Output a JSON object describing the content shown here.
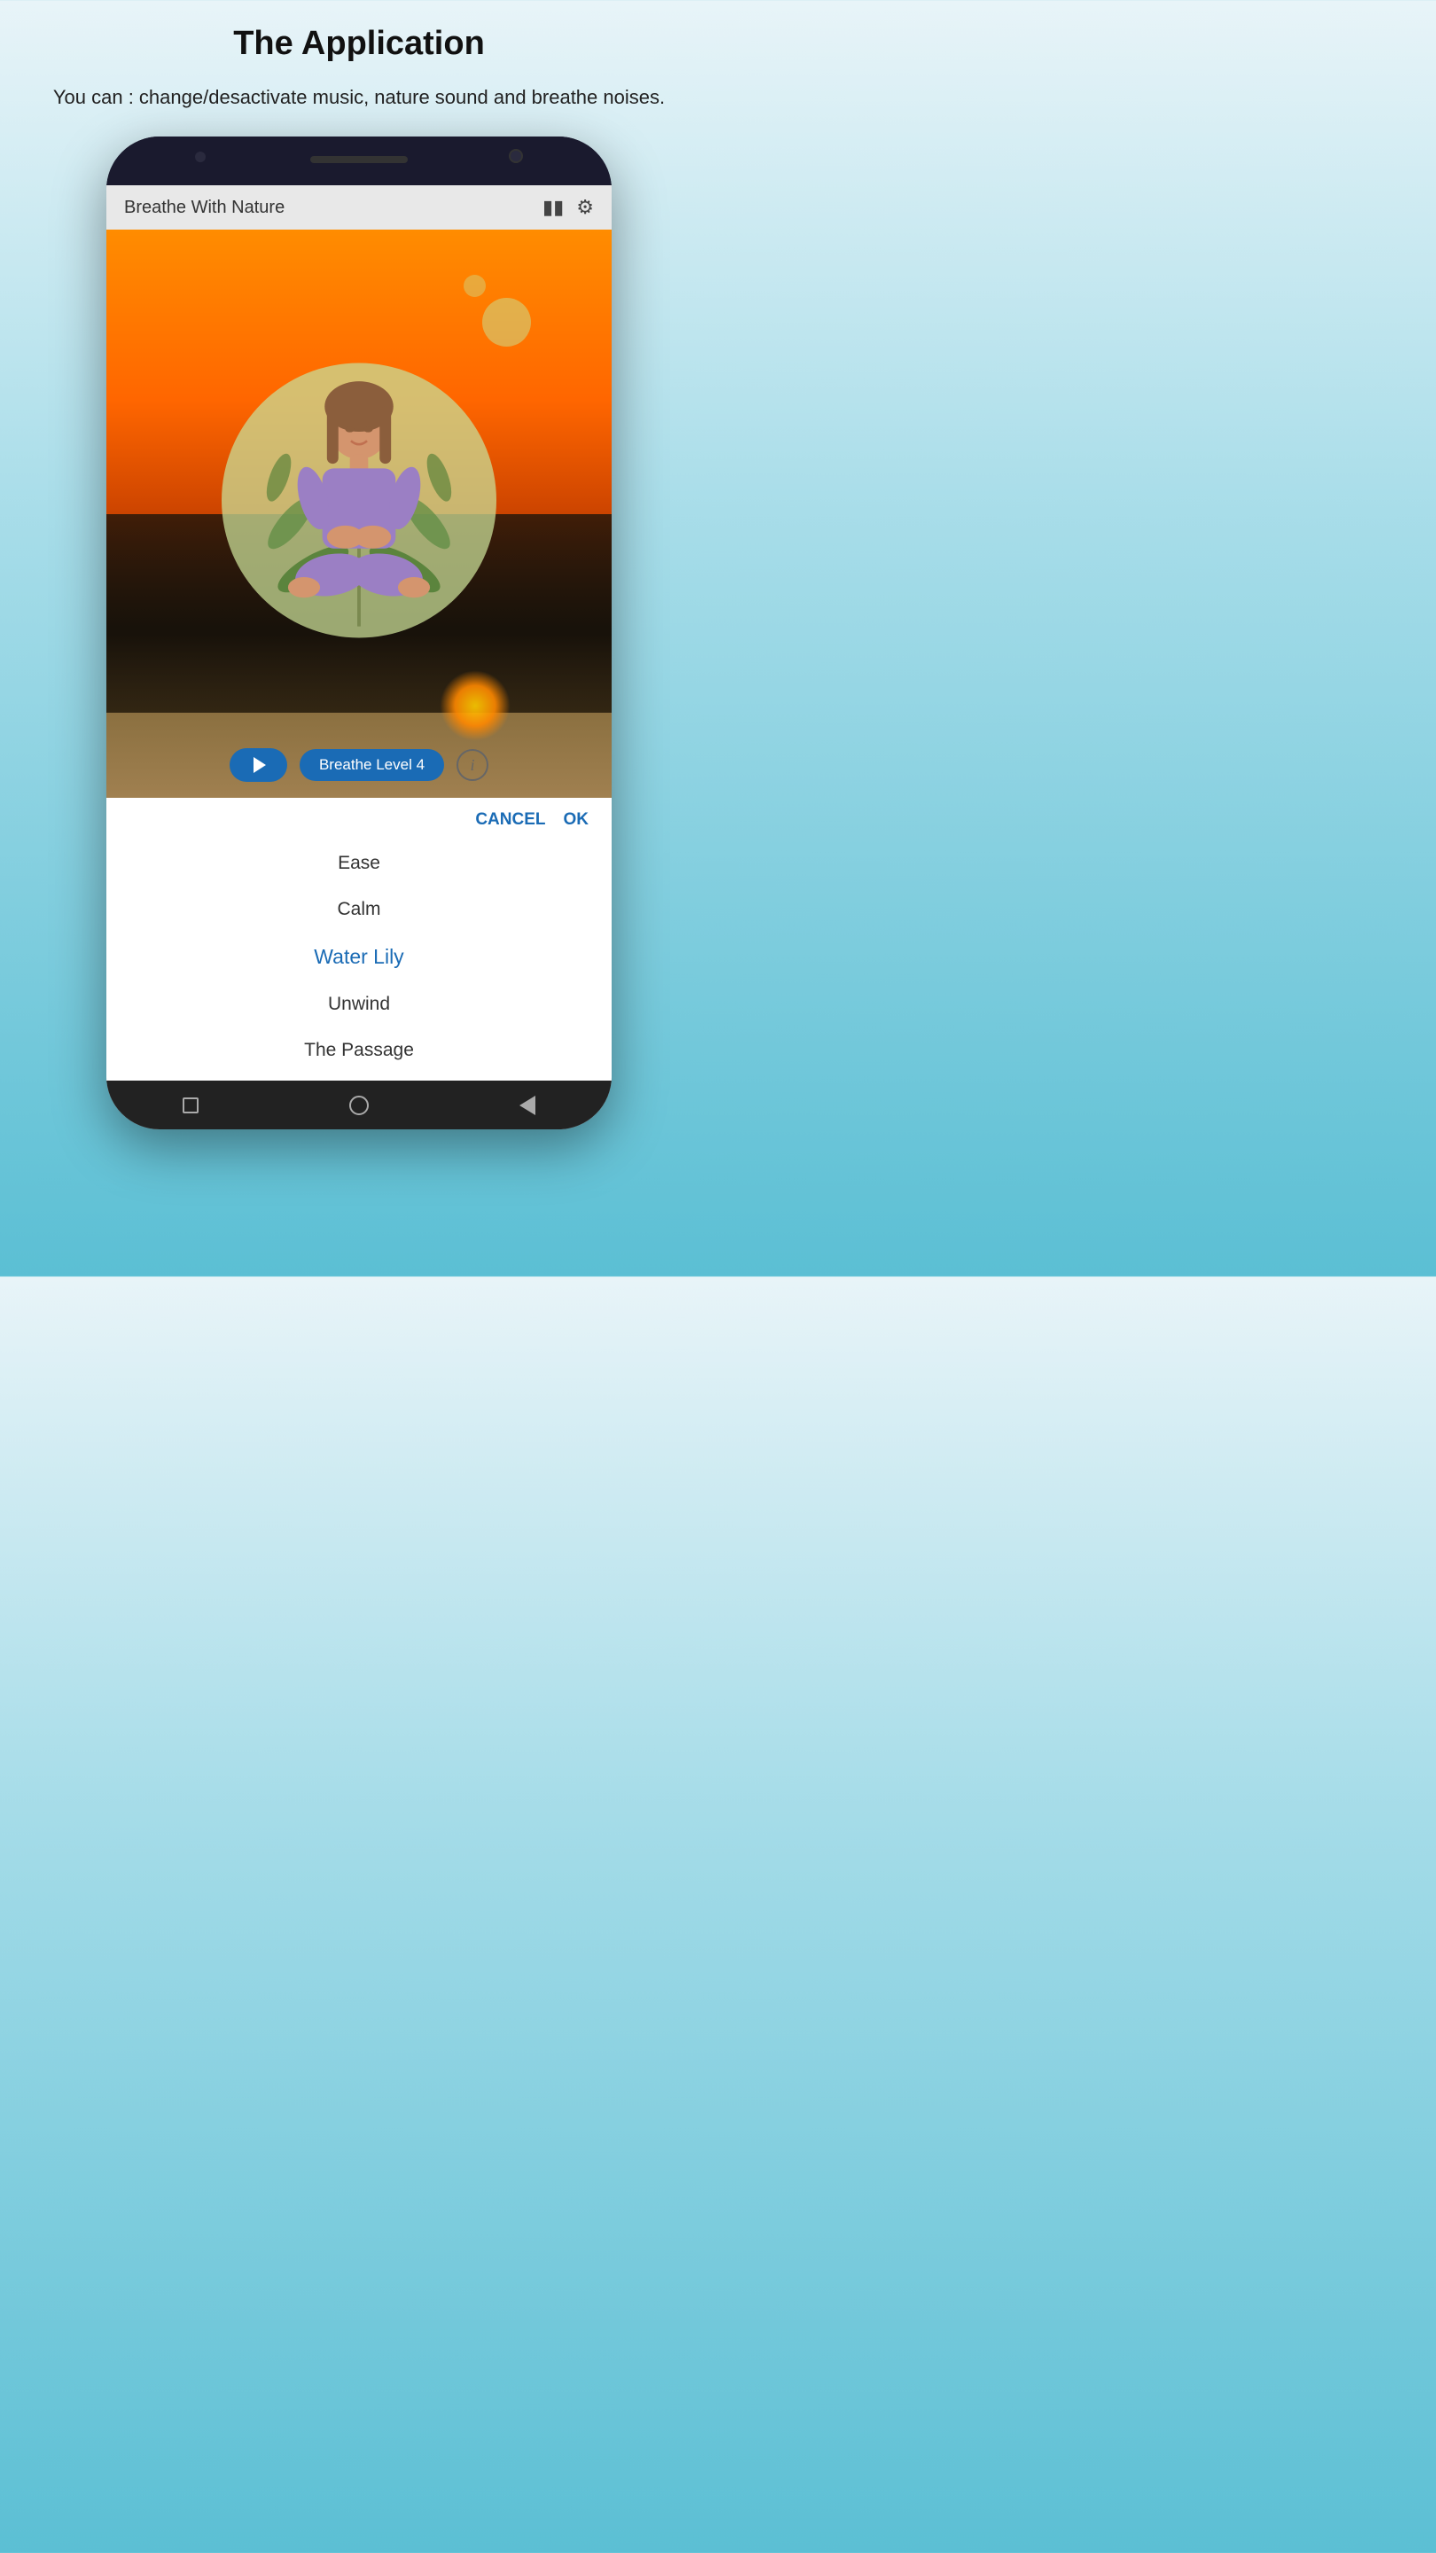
{
  "header": {
    "title": "The Application",
    "subtitle": "You can : change/desactivate music, nature sound and breathe noises."
  },
  "app": {
    "name": "Breathe With Nature",
    "breathe_level_label": "Breathe Level 4"
  },
  "dialog": {
    "cancel_label": "CANCEL",
    "ok_label": "OK",
    "picker_items": [
      {
        "label": "Ease",
        "selected": false
      },
      {
        "label": "Calm",
        "selected": false
      },
      {
        "label": "Water Lily",
        "selected": true
      },
      {
        "label": "Unwind",
        "selected": false
      },
      {
        "label": "The Passage",
        "selected": false
      }
    ]
  },
  "nav": {
    "square_icon": "□",
    "circle_icon": "○",
    "back_icon": "◁"
  },
  "colors": {
    "accent": "#1a6bb5",
    "selected_text": "#1a6bb5",
    "bg_gradient_top": "#e8f4f8",
    "bg_gradient_bottom": "#5bbfd4"
  }
}
